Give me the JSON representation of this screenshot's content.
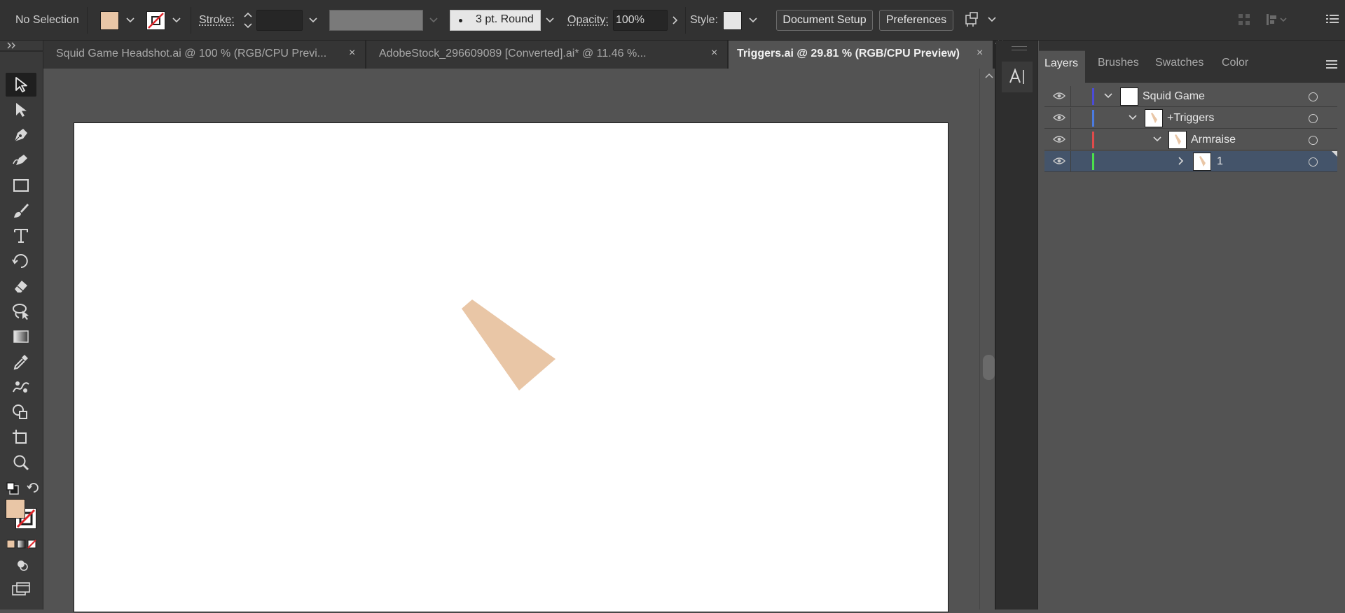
{
  "control_bar": {
    "selection_label": "No Selection",
    "stroke_label": "Stroke:",
    "brush_profile": "3 pt. Round",
    "opacity_label": "Opacity:",
    "opacity_value": "100%",
    "style_label": "Style:",
    "document_setup_label": "Document Setup",
    "preferences_label": "Preferences",
    "fill_color": "#e9c6a6"
  },
  "tabs": [
    {
      "label": "Squid Game Headshot.ai @ 100 % (RGB/CPU Previ...",
      "close": "×",
      "active": false
    },
    {
      "label": "AdobeStock_296609089 [Converted].ai* @ 11.46 %...",
      "close": "×",
      "active": false
    },
    {
      "label": "Triggers.ai @ 29.81 % (RGB/CPU Preview)",
      "close": "×",
      "active": true
    }
  ],
  "panel_tabs": [
    "Layers",
    "Brushes",
    "Swatches",
    "Color"
  ],
  "layers": [
    {
      "name": "Squid Game",
      "color": "#4b4bd6",
      "expanded": true
    },
    {
      "name": "+Triggers",
      "color": "#4b7be0",
      "expanded": true
    },
    {
      "name": "Armraise",
      "color": "#e04b4b",
      "expanded": true
    },
    {
      "name": "1",
      "color": "#4be04b",
      "expanded": false,
      "selected": true
    }
  ],
  "artwork": {
    "shape_color": "#e9c6a6"
  },
  "toolbar_tools": [
    "selection-tool",
    "direct-selection-tool",
    "pen-tool",
    "curvature-tool",
    "rectangle-tool",
    "paintbrush-tool",
    "type-tool",
    "rotate-tool",
    "eraser-tool",
    "lasso-tool",
    "gradient-tool",
    "eyedropper-tool",
    "puppet-warp-tool",
    "shape-builder-tool",
    "artboard-tool",
    "zoom-tool"
  ]
}
